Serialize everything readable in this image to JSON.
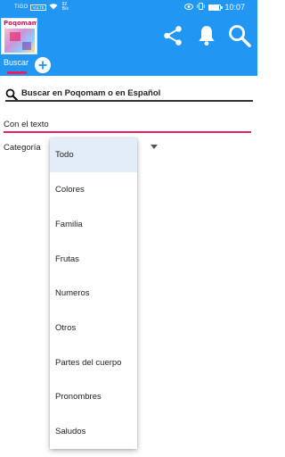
{
  "status_bar": {
    "carrier": "TIGO",
    "network_badge": "VoLTE",
    "speed_value": "92",
    "speed_unit": "B/s",
    "time": "10:07",
    "icons": [
      "wifi-icon",
      "eye-icon",
      "vibrate-icon",
      "battery-icon"
    ],
    "battery_level": 0.85
  },
  "app_bar": {
    "logo_text": "Poqomam",
    "icons": [
      "share-icon",
      "bell-icon",
      "search-icon"
    ]
  },
  "tabs": [
    {
      "label": "Buscar",
      "active": true
    }
  ],
  "search": {
    "label": "Buscar en Poqomam o en Español"
  },
  "form": {
    "text_label": "Con el texto",
    "text_value": "",
    "category_label": "Categoría"
  },
  "dropdown": {
    "options": [
      "Todo",
      "Colores",
      "Familia",
      "Frutas",
      "Numeros",
      "Otros",
      "Partes del cuerpo",
      "Pronombres",
      "Saludos"
    ],
    "selected": "Todo"
  },
  "colors": {
    "primary": "#2196f3",
    "accent": "#e91e63",
    "selected_item": "#e3edf8"
  }
}
